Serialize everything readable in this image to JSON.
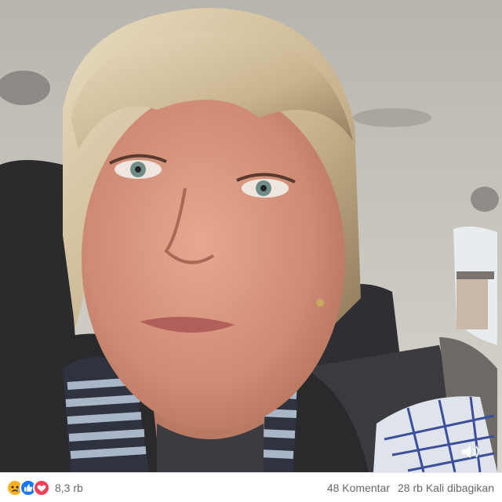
{
  "post": {
    "video": {
      "content": "woman-selfie-in-car",
      "volume_icon": "volume-icon"
    },
    "reactions": {
      "icons": [
        "sad-react-icon",
        "like-react-icon",
        "love-react-icon"
      ],
      "colors": {
        "sad": "#f7b125",
        "like": "#1877f2",
        "love": "#f33e58"
      },
      "count": "8,3 rb"
    },
    "stats": {
      "comments": "48 Komentar",
      "shares": "28 rb Kali dibagikan"
    }
  }
}
